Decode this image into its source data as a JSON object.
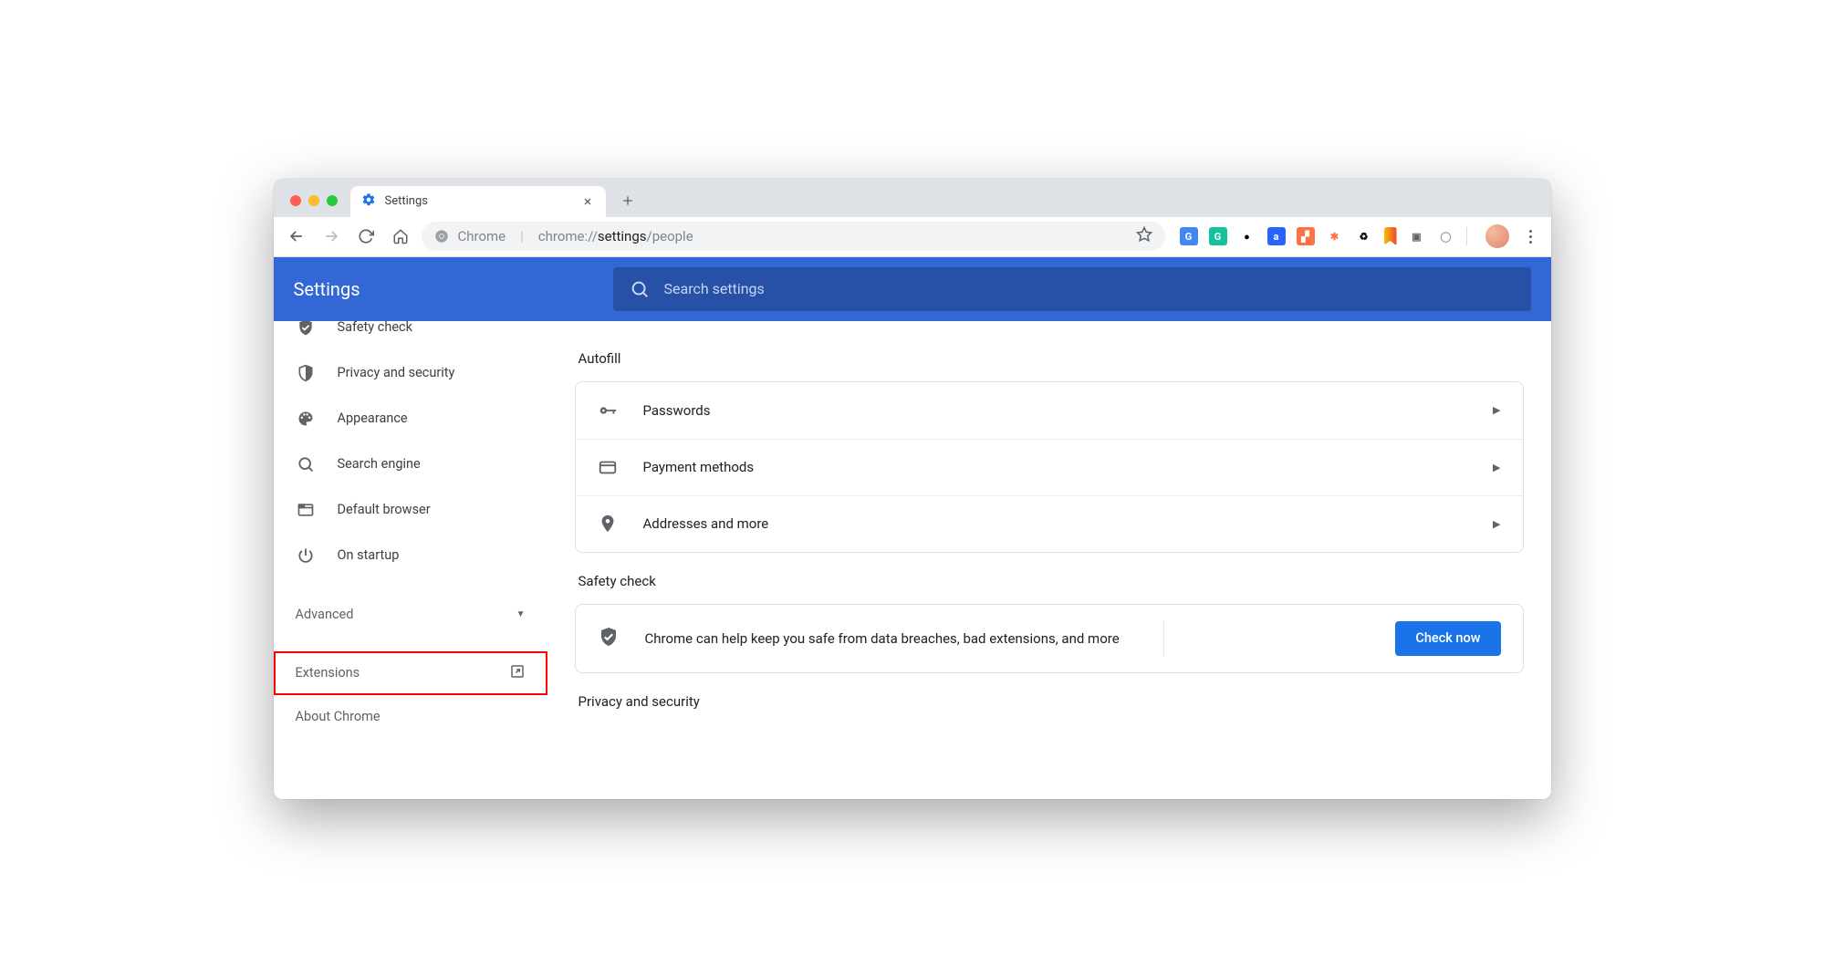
{
  "browser": {
    "tab_title": "Settings",
    "url_prefix": "Chrome",
    "url_path_host": "chrome://",
    "url_path_bold": "settings",
    "url_path_tail": "/people"
  },
  "header": {
    "title": "Settings",
    "search_placeholder": "Search settings"
  },
  "sidebar": {
    "items": [
      {
        "label": "Safety check",
        "icon": "shield-check"
      },
      {
        "label": "Privacy and security",
        "icon": "shield"
      },
      {
        "label": "Appearance",
        "icon": "palette"
      },
      {
        "label": "Search engine",
        "icon": "search"
      },
      {
        "label": "Default browser",
        "icon": "browser"
      },
      {
        "label": "On startup",
        "icon": "power"
      }
    ],
    "advanced": "Advanced",
    "extensions": "Extensions",
    "about": "About Chrome"
  },
  "main": {
    "autofill": {
      "title": "Autofill",
      "rows": [
        {
          "label": "Passwords",
          "icon": "key"
        },
        {
          "label": "Payment methods",
          "icon": "card"
        },
        {
          "label": "Addresses and more",
          "icon": "pin"
        }
      ]
    },
    "safety": {
      "title": "Safety check",
      "text": "Chrome can help keep you safe from data breaches, bad extensions, and more",
      "button": "Check now"
    },
    "privacy_title": "Privacy and security"
  },
  "ext_icons": [
    {
      "name": "translate",
      "bg": "#4285f4",
      "fg": "#fff",
      "glyph": "G"
    },
    {
      "name": "grammarly",
      "bg": "#15c39a",
      "fg": "#fff",
      "glyph": "G"
    },
    {
      "name": "similarweb",
      "bg": "#fff",
      "fg": "#000",
      "glyph": "●"
    },
    {
      "name": "amazon",
      "bg": "#2962ff",
      "fg": "#fff",
      "glyph": "a"
    },
    {
      "name": "analytics",
      "bg": "#ff7043",
      "fg": "#fff",
      "glyph": "▞"
    },
    {
      "name": "misc1",
      "bg": "#fff",
      "fg": "#ff7043",
      "glyph": "✱"
    },
    {
      "name": "recycle",
      "bg": "#fff",
      "fg": "#000",
      "glyph": "♻"
    },
    {
      "name": "bookmark",
      "bg": "linear-gradient(90deg,#fbbc04,#ea4335)",
      "fg": "#fff",
      "glyph": ""
    },
    {
      "name": "cast",
      "bg": "#fff",
      "fg": "#5f6368",
      "glyph": "▣"
    },
    {
      "name": "circle",
      "bg": "#fff",
      "fg": "#9aa0a6",
      "glyph": "◯"
    }
  ]
}
